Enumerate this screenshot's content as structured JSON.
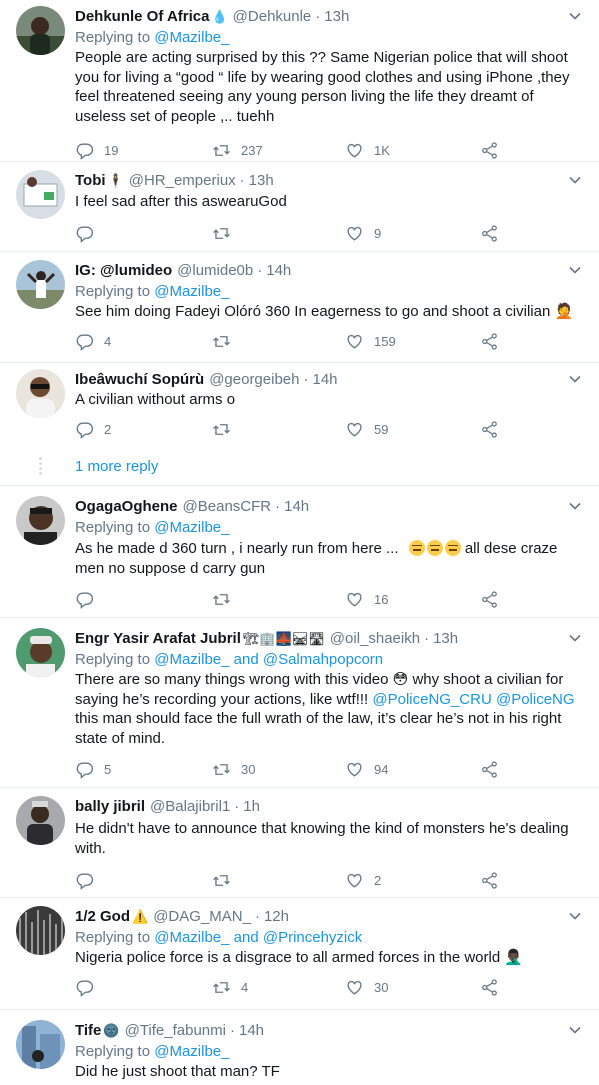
{
  "tweets": [
    {
      "name": "Dehkunle Of Africa",
      "name_emoji": "💧",
      "handle": "@Dehkunle",
      "time": "13h",
      "replying_label": "Replying to",
      "replying_to": "@Mazilbe_",
      "text": "People are acting surprised by this ?? Same Nigerian police that will shoot you for living a “good “ life by wearing good clothes and using iPhone ,they feel threatened seeing any young person living the life they dreamt of useless set of people ,.. tuehh",
      "replies": "19",
      "retweets": "237",
      "likes": "1K"
    },
    {
      "name": "Tobi",
      "name_emoji": "🕴",
      "handle": "@HR_emperiux",
      "time": "13h",
      "text": "I feel sad  after this aswearuGod",
      "replies": "",
      "retweets": "",
      "likes": "9"
    },
    {
      "name": "IG: @lumideo",
      "handle": "@lumide0b",
      "time": "14h",
      "replying_label": "Replying to",
      "replying_to": "@Mazilbe_",
      "text": "See him doing Fadeyi Olóró 360 In eagerness to go and shoot a civilian",
      "text_emoji": "🤦",
      "replies": "4",
      "retweets": "",
      "likes": "159"
    },
    {
      "name": "Ibeâwuchí Sopúrù",
      "handle": "@georgeibeh",
      "time": "14h",
      "text": "A civilian without arms o",
      "replies": "2",
      "retweets": "",
      "likes": "59"
    },
    {
      "name": "OgagaOghene",
      "handle": "@BeansCFR",
      "time": "14h",
      "replying_label": "Replying to",
      "replying_to": "@Mazilbe_",
      "text_before": "As he made d 360 turn , i nearly run from here ...",
      "text_after": "all dese craze men no suppose d carry gun",
      "replies": "",
      "retweets": "",
      "likes": "16"
    },
    {
      "name": "Engr Yasir Arafat Jubril",
      "name_emoji": "🏗🏢🌉🛤🛣",
      "handle": "@oil_shaeikh",
      "time": "13h",
      "replying_label": "Replying to",
      "replying_to": "@Mazilbe_ and @Salmahpopcorn",
      "text_before": "There are so many things wrong with this video",
      "text_emoji": "😳",
      "text_mid": "why shoot a civilian for saying he’s recording your actions, like wtf!!!",
      "mention_1": "@PoliceNG_CRU",
      "mention_2": "@PoliceNG",
      "text_after": "this man should face the full wrath of the law, it’s clear he’s not in his right state of mind.",
      "replies": "5",
      "retweets": "30",
      "likes": "94"
    },
    {
      "name": "bally jibril",
      "handle": "@Balajibril1",
      "time": "1h",
      "text": "He didn't have to announce that knowing the kind of monsters he's dealing with.",
      "replies": "",
      "retweets": "",
      "likes": "2"
    },
    {
      "name": "1/2 God",
      "name_emoji": "⚠️",
      "handle": "@DAG_MAN_",
      "time": "12h",
      "replying_label": "Replying to",
      "replying_to": "@Mazilbe_ and @Princehyzick",
      "text": "Nigeria police force is a disgrace to all armed forces in the world",
      "text_emoji": "🤦🏿‍♂️",
      "replies": "",
      "retweets": "4",
      "likes": "30"
    },
    {
      "name": "Tife",
      "name_emoji": "🌚",
      "handle": "@Tife_fabunmi",
      "time": "14h",
      "replying_label": "Replying to",
      "replying_to": "@Mazilbe_",
      "text": "Did he just shoot that man? TF"
    }
  ],
  "more_replies": "1 more reply",
  "dot": "·"
}
